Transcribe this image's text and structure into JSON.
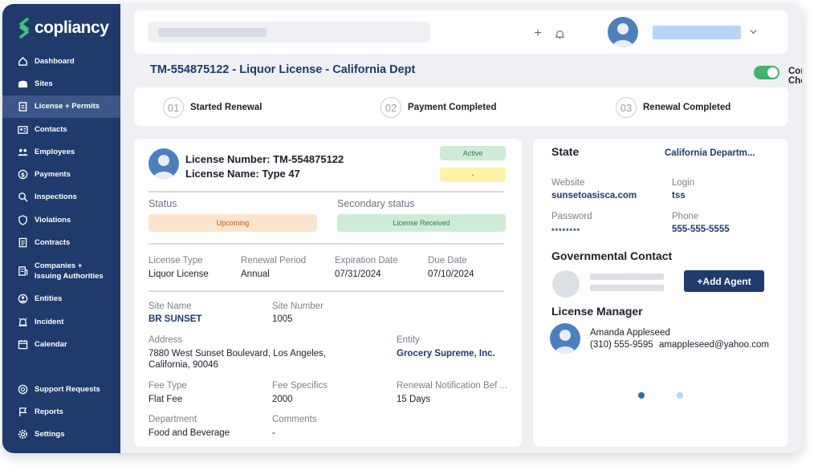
{
  "app": {
    "logo_text": "copliancy"
  },
  "sidebar": {
    "items": [
      {
        "label": "Dashboard",
        "icon": "home-icon"
      },
      {
        "label": "Sites",
        "icon": "sites-icon"
      },
      {
        "label": "License + Permits",
        "icon": "clipboard-icon",
        "active": true
      },
      {
        "label": "Contacts",
        "icon": "contacts-icon"
      },
      {
        "label": "Employees",
        "icon": "employees-icon"
      },
      {
        "label": "Payments",
        "icon": "dollar-icon"
      },
      {
        "label": "Inspections",
        "icon": "search-icon"
      },
      {
        "label": "Violations",
        "icon": "shield-icon"
      },
      {
        "label": "Contracts",
        "icon": "document-icon"
      },
      {
        "label": "Companies +",
        "label2": "Issuing Authorities",
        "icon": "building-icon"
      },
      {
        "label": "Entities",
        "icon": "entity-icon"
      },
      {
        "label": "Incident",
        "icon": "alarm-icon"
      },
      {
        "label": "Calendar",
        "icon": "calendar-icon"
      }
    ],
    "bottom": [
      {
        "label": "Support Requests",
        "icon": "support-icon"
      },
      {
        "label": "Reports",
        "icon": "flag-icon"
      },
      {
        "label": "Settings",
        "icon": "gear-icon"
      }
    ]
  },
  "header": {
    "title": "TM-554875122 - Liquor License - California Dept",
    "compliance_label": "Compliance Check"
  },
  "steps": [
    {
      "num": "01",
      "label": "Started Renewal"
    },
    {
      "num": "02",
      "label": "Payment Completed"
    },
    {
      "num": "03",
      "label": "Renewal Completed"
    }
  ],
  "license": {
    "number_line": "License Number:  TM-554875122",
    "name_line": "License Name:  Type 47",
    "badge_active": "Active",
    "badge_second": "-",
    "status_label": "Status",
    "status_value": "Upcoming",
    "secondary_label": "Secondary status",
    "secondary_value": "License Received",
    "fields": {
      "license_type_label": "License Type",
      "license_type": "Liquor License",
      "renewal_period_label": "Renewal Period",
      "renewal_period": "Annual",
      "expiration_label": "Expiration Date",
      "expiration": "07/31/2024",
      "due_label": "Due Date",
      "due": "07/10/2024",
      "site_name_label": "Site Name",
      "site_name": "BR SUNSET",
      "site_number_label": "Site Number",
      "site_number": "1005",
      "address_label": "Address",
      "address1": "7880 West Sunset Boulevard, Los Angeles,",
      "address2": "California, 90046",
      "entity_label": "Entity",
      "entity": "Grocery Supreme, Inc.",
      "fee_type_label": "Fee Type",
      "fee_type": "Flat Fee",
      "fee_specifics_label": "Fee Specifics",
      "fee_specifics": "2000",
      "renewal_notif_label": "Renewal Notification Bef ...",
      "renewal_notif": "15 Days",
      "department_label": "Department",
      "department": "Food and Beverage",
      "comments_label": "Comments",
      "comments": "-"
    }
  },
  "state_panel": {
    "state_label": "State",
    "state_value": "California Departm...",
    "website_label": "Website",
    "website": "sunsetoasisca.com",
    "login_label": "Login",
    "login": "tss",
    "password_label": "Password",
    "password": "********",
    "phone_label": "Phone",
    "phone": "555-555-5555",
    "gov_contact_label": "Governmental Contact",
    "add_agent_label": "+Add Agent",
    "manager_label": "License Manager",
    "manager_name": "Amanda Appleseed",
    "manager_phone": "(310) 555-9595",
    "manager_email": "amappleseed@yahoo.com"
  },
  "colors": {
    "sidebar": "#1f3a6b",
    "accent": "#1f3a6b",
    "toggle_on": "#3fb46a",
    "badge_active_bg": "#cdebd6",
    "badge_pending_bg": "#fcf3a8",
    "upcoming_bg": "#fde4cc",
    "received_bg": "#cdebd6"
  }
}
